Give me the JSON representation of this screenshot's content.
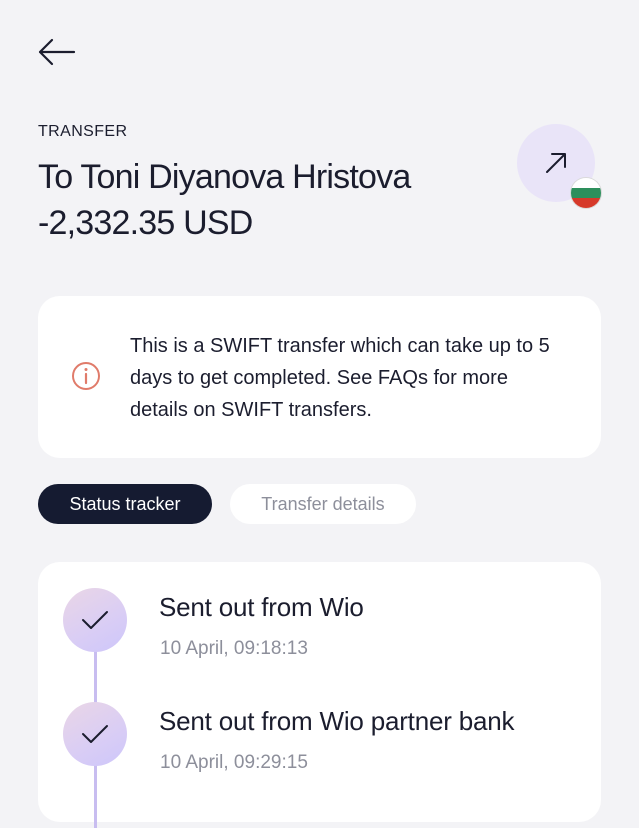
{
  "header": {
    "back_icon": "arrow-left-icon",
    "eyebrow": "TRANSFER",
    "title": "To Toni Diyanova Hristova",
    "amount": "-2,332.35 USD",
    "avatar_icon": "arrow-up-right-icon",
    "flag_icon": "bulgaria-flag-icon"
  },
  "notice": {
    "icon": "info-icon",
    "text": "This is a SWIFT transfer which can take up to 5 days to get completed. See FAQs for more details on SWIFT transfers."
  },
  "tabs": [
    {
      "label": "Status tracker",
      "active": true
    },
    {
      "label": "Transfer details",
      "active": false
    }
  ],
  "tracker": {
    "steps": [
      {
        "title": "Sent out from Wio",
        "time": "10 April, 09:18:13",
        "icon": "check-icon"
      },
      {
        "title": "Sent out from Wio partner bank",
        "time": "10 April, 09:29:15",
        "icon": "check-icon"
      }
    ]
  },
  "colors": {
    "background": "#f3f3f6",
    "primary_dark": "#151b31",
    "accent_lavender": "#e9e4f8",
    "info_icon": "#e07b6a",
    "timeline": "#c8bdf0"
  }
}
